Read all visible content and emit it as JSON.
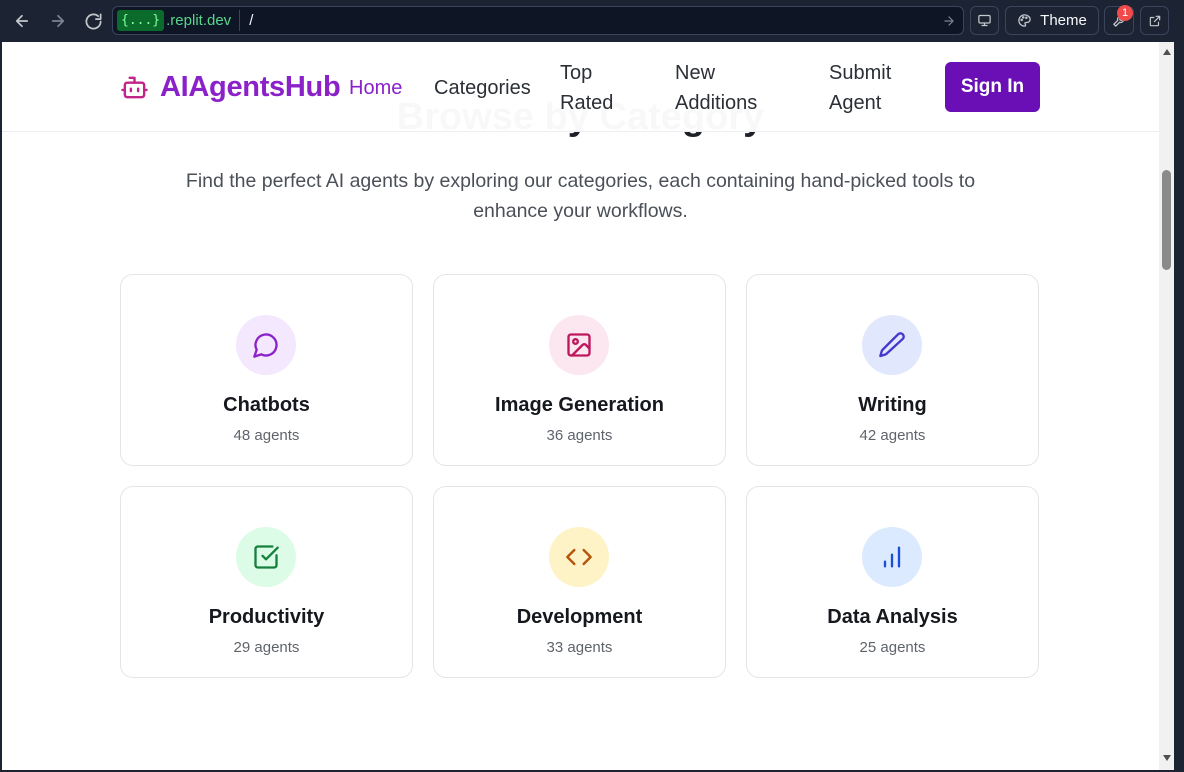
{
  "browser": {
    "url_badge": "{...}",
    "url_domain": ".replit.dev",
    "url_path": "/",
    "theme_label": "Theme",
    "notification_count": "1"
  },
  "site": {
    "logo_text": "AIAgentsHub",
    "nav": {
      "home": "Home",
      "categories": "Categories",
      "top_rated_1": "Top",
      "top_rated_2": "Rated",
      "new_additions_1": "New",
      "new_additions_2": "Additions",
      "submit_agent_1": "Submit",
      "submit_agent_2": "Agent"
    },
    "sign_in": "Sign In"
  },
  "section": {
    "title": "Browse by Category",
    "intro_line1": "Find the perfect AI agents by exploring our categories, each containing hand-picked tools to",
    "intro_line2": "enhance your workflows."
  },
  "categories": [
    {
      "name": "Chatbots",
      "count": "48 agents",
      "icon": "message-circle-icon",
      "bg": "#f3e8fd",
      "color": "#8b21c9"
    },
    {
      "name": "Image Generation",
      "count": "36 agents",
      "icon": "image-icon",
      "bg": "#fce7f1",
      "color": "#be185d"
    },
    {
      "name": "Writing",
      "count": "42 agents",
      "icon": "pencil-icon",
      "bg": "#e1e7fd",
      "color": "#4338ca"
    },
    {
      "name": "Productivity",
      "count": "29 agents",
      "icon": "check-square-icon",
      "bg": "#dcfce7",
      "color": "#15803d"
    },
    {
      "name": "Development",
      "count": "33 agents",
      "icon": "code-icon",
      "bg": "#fef3c7",
      "color": "#b45309"
    },
    {
      "name": "Data Analysis",
      "count": "25 agents",
      "icon": "bar-chart-icon",
      "bg": "#dbeafe",
      "color": "#1d4ed8"
    }
  ]
}
